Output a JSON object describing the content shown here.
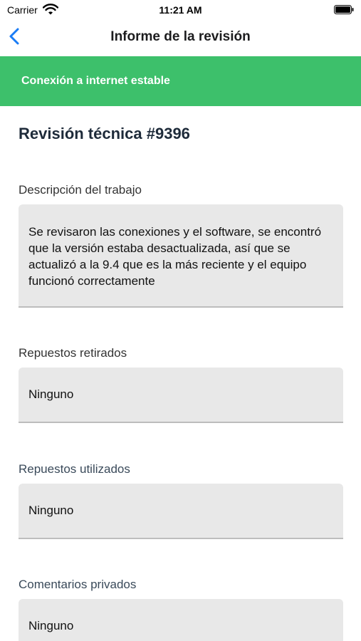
{
  "status_bar": {
    "carrier": "Carrier",
    "time": "11:21 AM"
  },
  "nav": {
    "title": "Informe de la revisión"
  },
  "banner": {
    "text": "Conexión a internet estable",
    "color": "#3dc06b"
  },
  "page": {
    "title": "Revisión técnica #9396"
  },
  "fields": [
    {
      "label": "Descripción del trabajo",
      "value": "Se revisaron las conexiones y el software, se encontró que la versión estaba desactualizada, así que se actualizó a la 9.4 que es la más reciente y el equipo funcionó correctamente"
    },
    {
      "label": "Repuestos retirados",
      "value": "Ninguno"
    },
    {
      "label": "Repuestos utilizados",
      "value": "Ninguno"
    },
    {
      "label": "Comentarios privados",
      "value": "Ninguno"
    }
  ]
}
